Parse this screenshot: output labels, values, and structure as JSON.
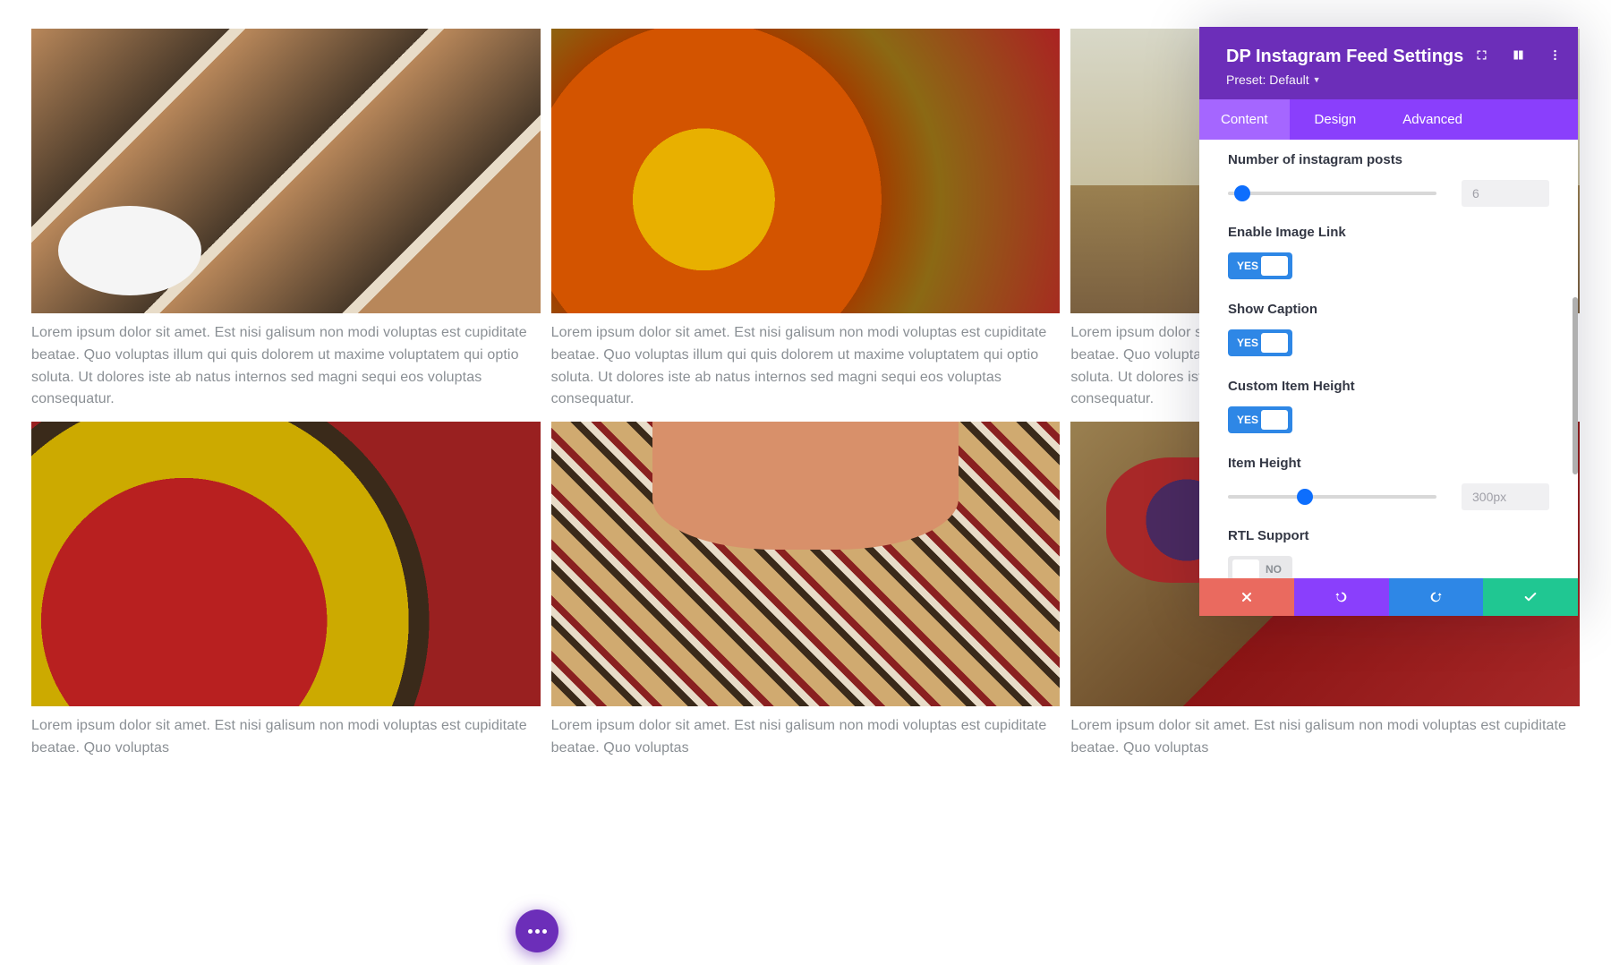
{
  "grid": {
    "caption": "Lorem ipsum dolor sit amet. Est nisi galisum non modi voluptas est cupiditate beatae. Quo voluptas illum qui quis dolorem ut maxime voluptatem qui optio soluta. Ut dolores iste ab natus internos sed magni sequi eos voluptas consequatur.",
    "caption_short_a": "Lorem ipsum dolor sit amet. Est nisi galisum non modi voluptas est cupiditate beatae. Quo voluptas",
    "caption_short_b": "Lorem ipsum dolor sit amet. Est nisi galisum non modi voluptas est cupiditate beatae. Quo voluptas"
  },
  "panel": {
    "title": "DP Instagram Feed Settings",
    "preset_label": "Preset: Default",
    "tabs": {
      "content": "Content",
      "design": "Design",
      "advanced": "Advanced"
    },
    "fields": {
      "posts_label": "Number of instagram posts",
      "posts_value": "6",
      "posts_slider_percent": 7,
      "enable_link_label": "Enable Image Link",
      "enable_link": "YES",
      "show_caption_label": "Show Caption",
      "show_caption": "YES",
      "custom_height_label": "Custom Item Height",
      "custom_height": "YES",
      "item_height_label": "Item Height",
      "item_height_value": "300px",
      "item_height_slider_percent": 37,
      "rtl_label": "RTL Support",
      "rtl": "NO"
    }
  }
}
